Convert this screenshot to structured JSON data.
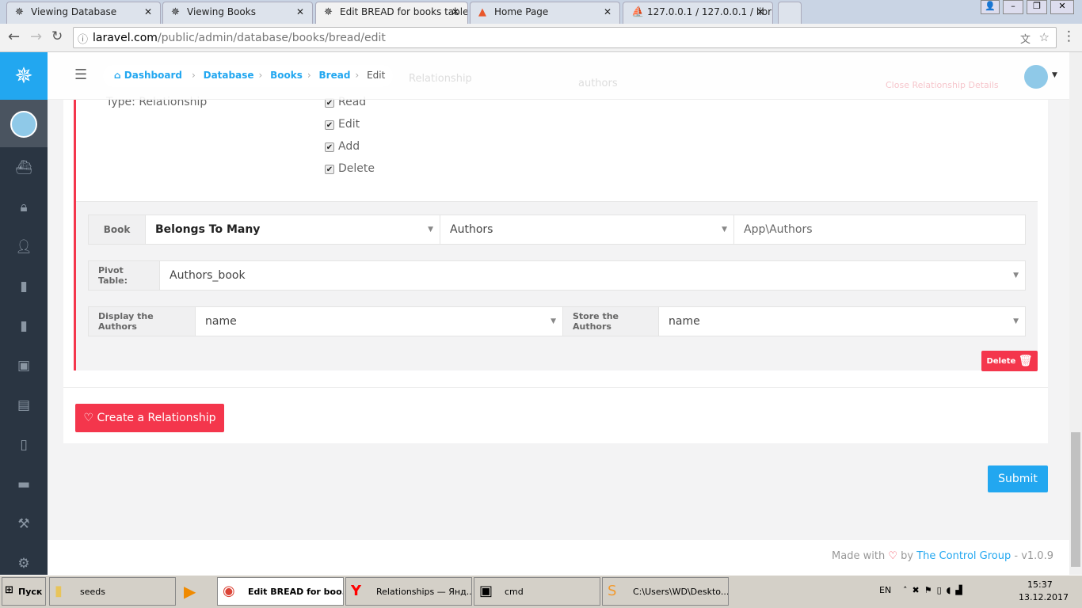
{
  "browser": {
    "tabs": [
      {
        "title": "Viewing Database",
        "icon": "wheel-icon"
      },
      {
        "title": "Viewing Books",
        "icon": "wheel-icon"
      },
      {
        "title": "Edit BREAD for books table",
        "icon": "wheel-icon",
        "active": true
      },
      {
        "title": "Home Page",
        "icon": "laravel-icon"
      },
      {
        "title": "127.0.0.1 / 127.0.0.1 / libr",
        "icon": "pma-icon"
      }
    ],
    "url_host": "laravel.com",
    "url_path": "/public/admin/database/books/bread/edit"
  },
  "breadcrumb": [
    "Dashboard",
    "Database",
    "Books",
    "Bread",
    "Edit"
  ],
  "ghost": {
    "relationship": "Relationship",
    "authors": "authors",
    "close": "Close Relationship Details"
  },
  "relationship": {
    "type_label": "Type:",
    "type_value": "Relationship",
    "permissions": [
      "Read",
      "Edit",
      "Add",
      "Delete"
    ],
    "book_label": "Book",
    "rel_type": "Belongs To Many",
    "model_table": "Authors",
    "model_class": "App\\Authors",
    "pivot_label": "Pivot Table:",
    "pivot_value": "Authors_book",
    "display_label": "Display the Authors",
    "display_value": "name",
    "store_label": "Store the Authors",
    "store_value": "name",
    "delete_label": "Delete"
  },
  "create_label": "Create a Relationship",
  "submit_label": "Submit",
  "footer": {
    "made": "Made with",
    "by": "by",
    "link": "The Control Group",
    "version": "- v1.0.9"
  },
  "taskbar": {
    "start": "Пуск",
    "items": [
      "seeds",
      "Edit BREAD for boo...",
      "Relationships — Янд...",
      "cmd",
      "C:\\Users\\WD\\Deskto..."
    ],
    "lang": "EN",
    "time": "15:37",
    "date": "13.12.2017"
  },
  "colors": {
    "accent": "#22a7f0",
    "danger": "#f4364c"
  }
}
